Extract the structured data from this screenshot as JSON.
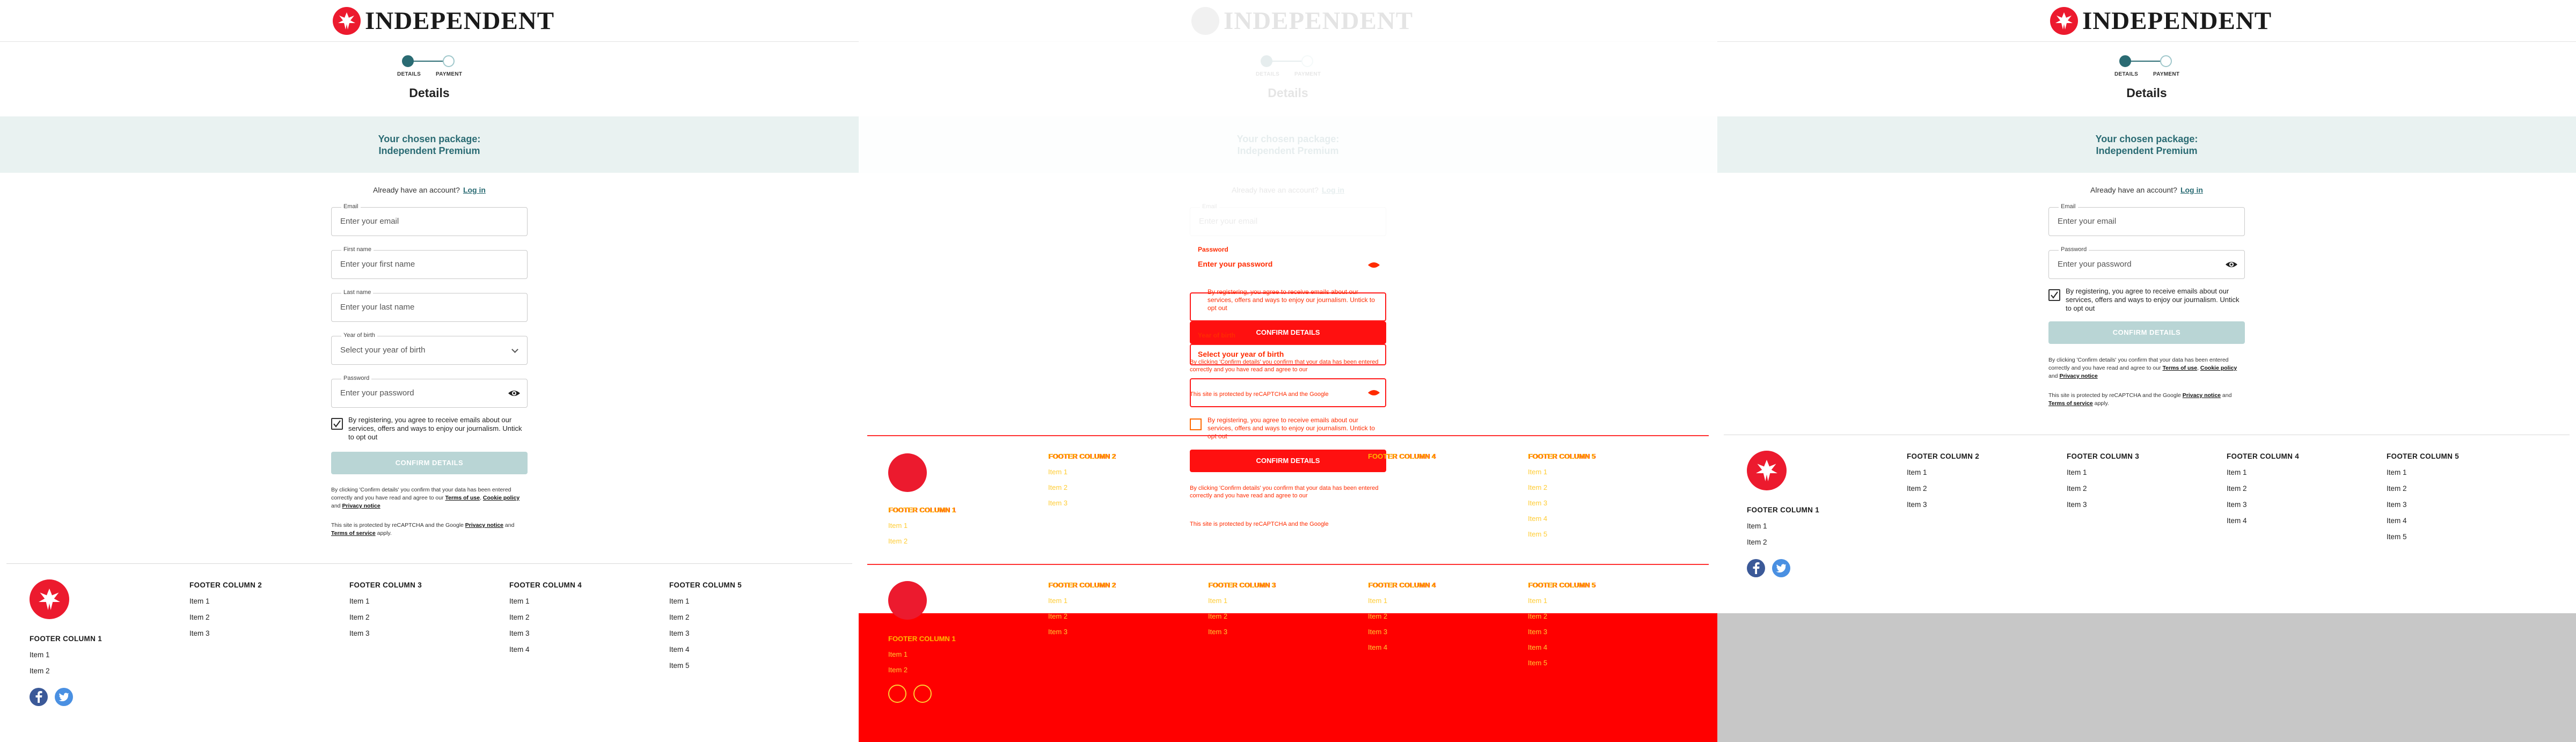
{
  "brand": {
    "name": "INDEPENDENT"
  },
  "stepper": {
    "step1": "DETAILS",
    "step2": "PAYMENT"
  },
  "page_title": "Details",
  "package": {
    "line1": "Your chosen package:",
    "line2": "Independent Premium"
  },
  "account": {
    "prompt": "Already have an account?",
    "login": "Log in"
  },
  "form_full": {
    "email": {
      "label": "Email",
      "placeholder": "Enter your email"
    },
    "first_name": {
      "label": "First name",
      "placeholder": "Enter your first name"
    },
    "last_name": {
      "label": "Last name",
      "placeholder": "Enter your last name"
    },
    "year": {
      "label": "Year of birth",
      "placeholder": "Select your year of birth"
    },
    "password": {
      "label": "Password",
      "placeholder": "Enter your password"
    }
  },
  "consent": {
    "text": "By registering, you agree to receive emails about our services, offers and ways to enjoy our journalism. Untick to opt out"
  },
  "confirm_label": "CONFIRM DETAILS",
  "legal": {
    "p1_a": "By clicking 'Confirm details' you confirm that your data has been entered correctly and you have read and agree to our",
    "terms": "Terms of use",
    "cookie": "Cookie policy",
    "and": "and",
    "privacy": "Privacy notice",
    "p2_a": "This site is protected by reCAPTCHA and the Google",
    "privacy2": "Privacy notice",
    "terms2": "Terms of service",
    "apply": "apply."
  },
  "footer": {
    "col1": {
      "title": "FOOTER COLUMN 1",
      "items": [
        "Item 1",
        "Item 2"
      ]
    },
    "col2": {
      "title": "FOOTER COLUMN 2",
      "items": [
        "Item 1",
        "Item 2",
        "Item 3"
      ]
    },
    "col3": {
      "title": "FOOTER COLUMN 3",
      "items": [
        "Item 1",
        "Item 2",
        "Item 3"
      ]
    },
    "col4": {
      "title": "FOOTER COLUMN 4",
      "items": [
        "Item 1",
        "Item 2",
        "Item 3",
        "Item 4"
      ]
    },
    "col5": {
      "title": "FOOTER COLUMN 5",
      "items": [
        "Item 1",
        "Item 2",
        "Item 3",
        "Item 4",
        "Item 5"
      ]
    }
  },
  "colors": {
    "accent": "#2a6b73",
    "brand_red": "#ec1a2e",
    "diff_red": "#ff0000",
    "diff_orange": "#ffb300"
  },
  "icons": [
    "eagle-logo-icon",
    "chevron-down-icon",
    "eye-icon",
    "checkbox-icon",
    "facebook-icon",
    "twitter-icon"
  ]
}
